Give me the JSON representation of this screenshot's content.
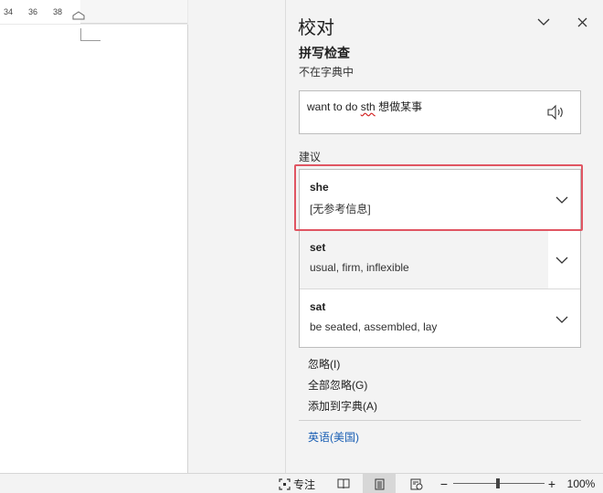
{
  "ruler": {
    "ticks": [
      "34",
      "36",
      "38"
    ]
  },
  "pane": {
    "title": "校对",
    "section_title": "拼写检查",
    "section_subtitle": "不在字典中",
    "context": {
      "before": "want to do ",
      "error_word": "sth",
      "after": " 想做某事"
    },
    "suggestions_label": "建议",
    "suggestions": [
      {
        "word": "she",
        "meaning": "[无参考信息]"
      },
      {
        "word": "set",
        "meaning": "usual, firm, inflexible"
      },
      {
        "word": "sat",
        "meaning": "be seated, assembled, lay"
      }
    ],
    "actions": {
      "ignore": "忽略(I)",
      "ignore_all": "全部忽略(G)",
      "add_to_dictionary": "添加到字典(A)"
    },
    "language": "英语(美国)"
  },
  "status_bar": {
    "focus": "专注",
    "zoom_out": "−",
    "zoom_in": "+",
    "zoom": "100%",
    "zoom_fraction": 0.5
  },
  "colors": {
    "highlight": "#e05562",
    "link": "#1a5fb4",
    "error_underline": "#d42a2a"
  }
}
